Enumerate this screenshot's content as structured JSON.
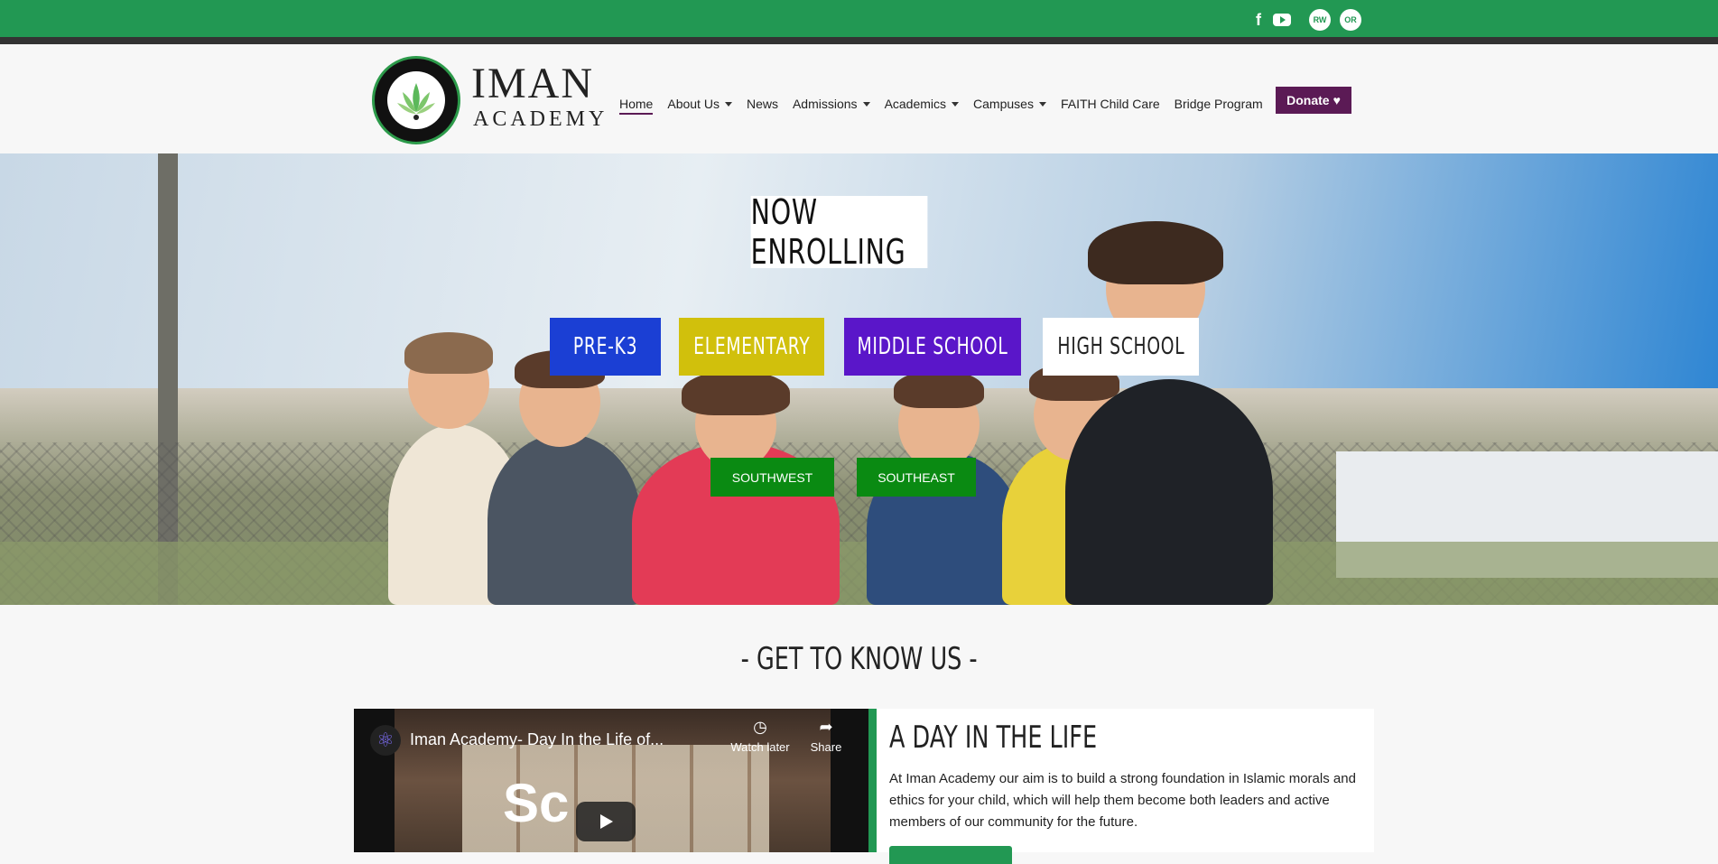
{
  "topbar": {
    "social": [
      {
        "icon": "facebook-icon",
        "label": "f"
      },
      {
        "icon": "youtube-icon",
        "label": ""
      },
      {
        "icon": "rw-icon",
        "label": "RW"
      },
      {
        "icon": "or-icon",
        "label": "OR"
      }
    ]
  },
  "brand": {
    "line1": "IMAN",
    "line2": "ACADEMY"
  },
  "nav": {
    "items": [
      "Home",
      "About Us",
      "News",
      "Admissions",
      "Academics",
      "Campuses",
      "FAITH Child Care",
      "Bridge Program"
    ],
    "donate": "Donate"
  },
  "hero": {
    "headline": "NOW ENROLLING",
    "levels": [
      "PRE-K3",
      "ELEMENTARY",
      "MIDDLE SCHOOL",
      "HIGH SCHOOL"
    ],
    "campuses": [
      "SOUTHWEST",
      "SOUTHEAST"
    ]
  },
  "section": {
    "title": "- GET TO KNOW US -"
  },
  "video": {
    "title": "Iman Academy- Day In the Life of...",
    "watch_later": "Watch later",
    "share": "Share",
    "overlay_text": "Sc"
  },
  "day": {
    "title": "A DAY IN THE LIFE",
    "body": "At Iman Academy our aim is to build a strong foundation in Islamic morals and ethics for your child, which will help them become both leaders and active members of our community for the future."
  },
  "colors": {
    "primary_green": "#229853",
    "donate_purple": "#5b1a55",
    "prek": "#1b3fd4",
    "elementary": "#d1c00c",
    "middle": "#5a16c9",
    "high": "#ffffff"
  }
}
